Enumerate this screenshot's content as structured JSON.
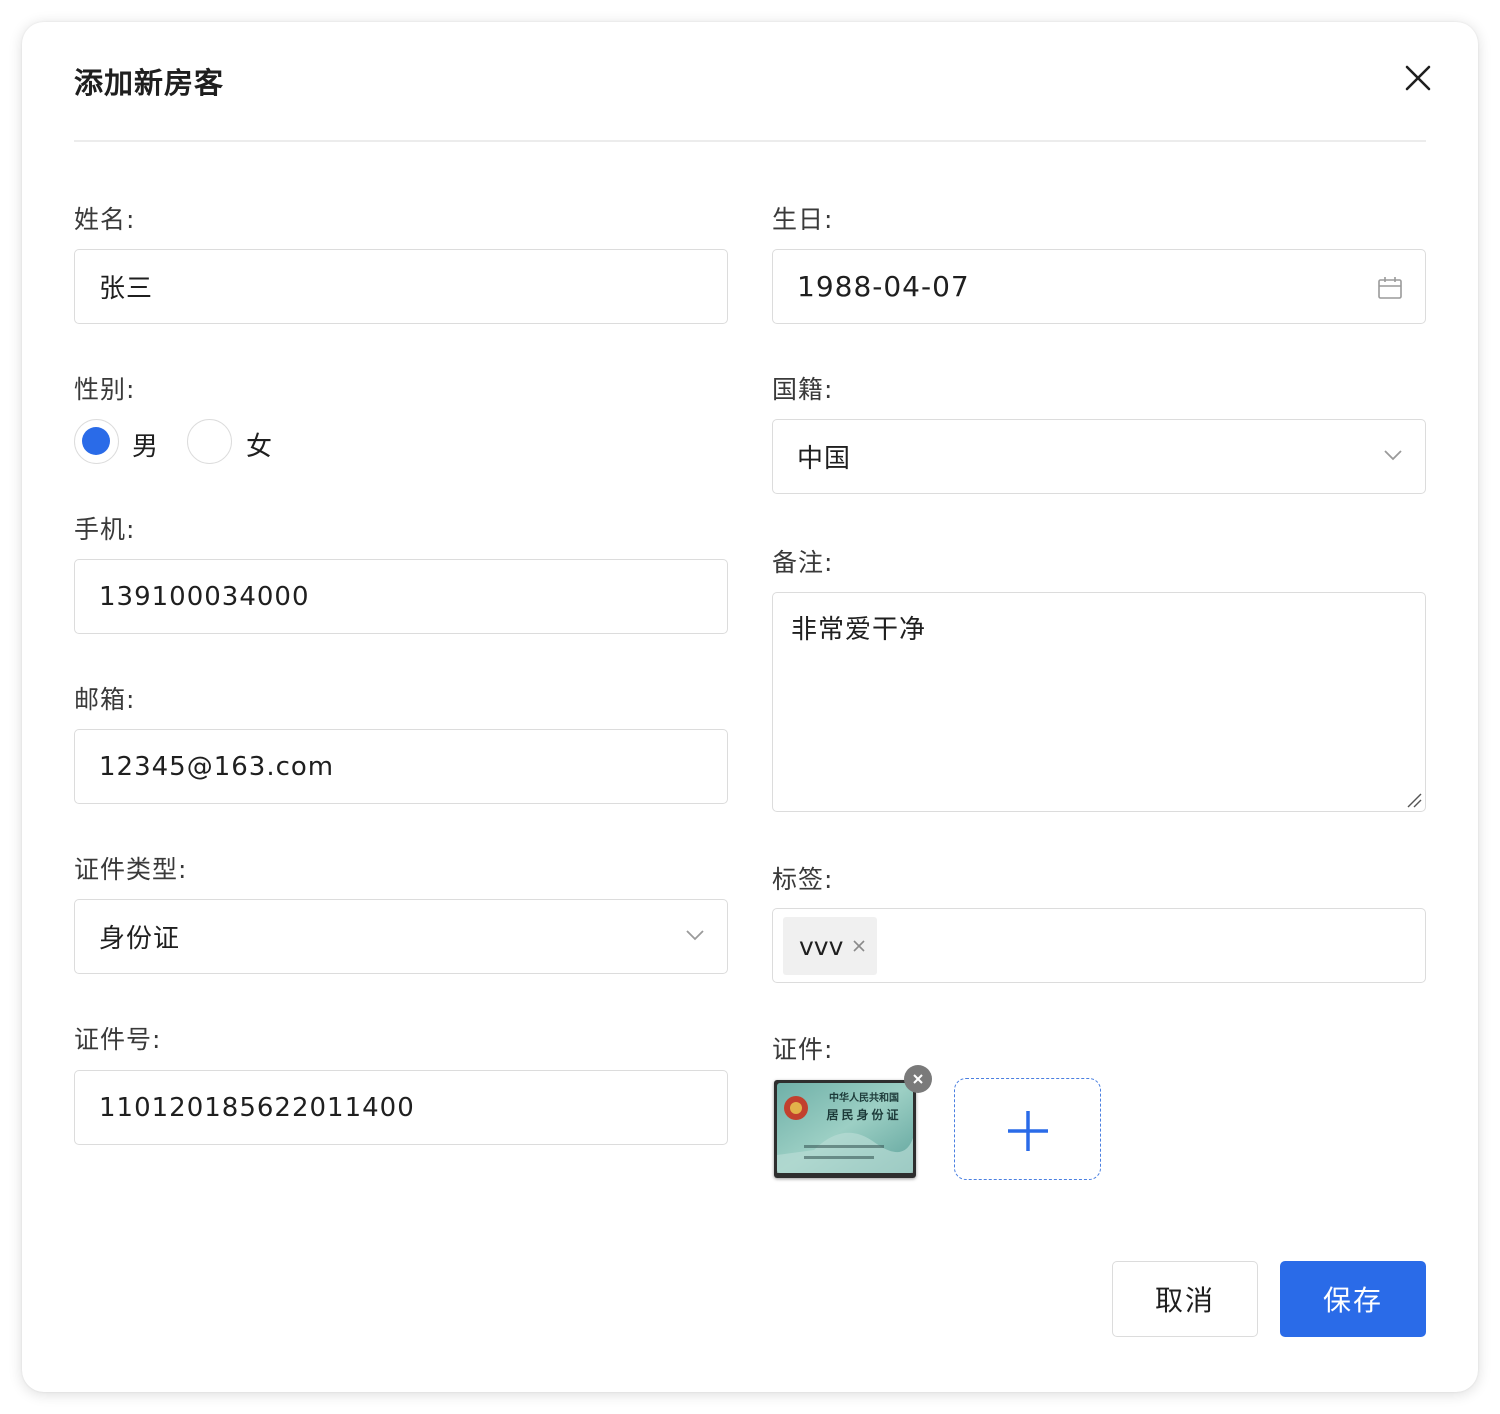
{
  "dialog": {
    "title": "添加新房客"
  },
  "form": {
    "name": {
      "label": "姓名:",
      "value": "张三"
    },
    "birthday": {
      "label": "生日:",
      "value": "1988-04-07"
    },
    "gender": {
      "label": "性别:",
      "options": [
        "男",
        "女"
      ],
      "selected": "男"
    },
    "nationality": {
      "label": "国籍:",
      "value": "中国"
    },
    "phone": {
      "label": "手机:",
      "value": "139100034000"
    },
    "notes": {
      "label": "备注:",
      "value": "非常爱干净"
    },
    "email": {
      "label": "邮箱:",
      "value": "12345@163.com"
    },
    "id_type": {
      "label": "证件类型:",
      "value": "身份证"
    },
    "tags": {
      "label": "标签:",
      "items": [
        "vvv"
      ]
    },
    "id_number": {
      "label": "证件号:",
      "value": "110120185622011400"
    },
    "documents": {
      "label": "证件:",
      "thumbnail_caption": "中华人民共和国 居民身份证"
    }
  },
  "buttons": {
    "cancel": "取消",
    "save": "保存"
  },
  "colors": {
    "primary": "#2a6be8",
    "border": "#dcdcdc"
  }
}
